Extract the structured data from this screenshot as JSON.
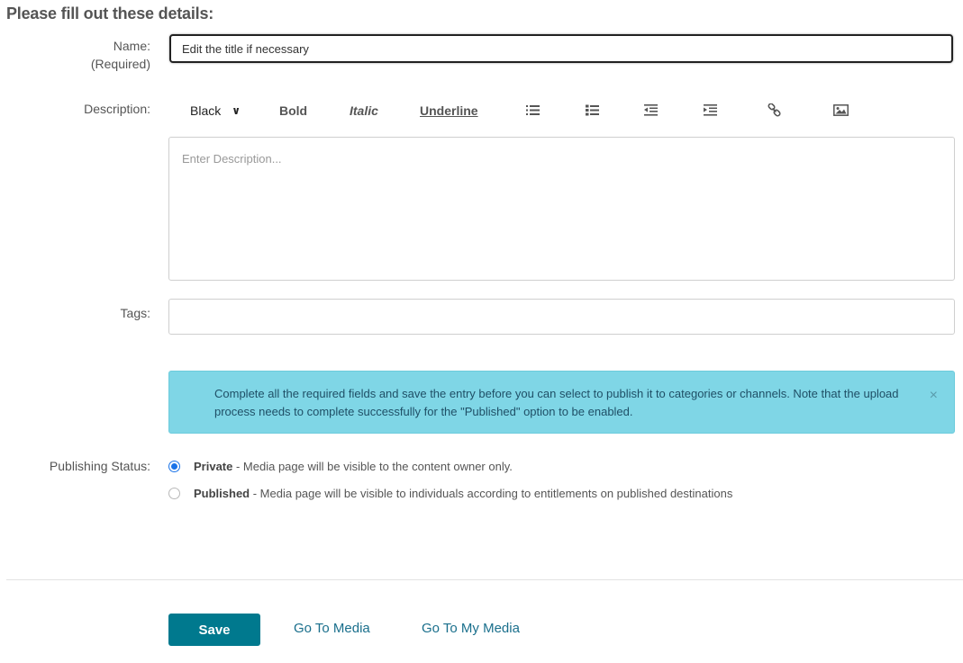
{
  "heading": "Please fill out these details:",
  "name": {
    "label": "Name:",
    "sublabel": "(Required)",
    "value": "Edit the title if necessary"
  },
  "description": {
    "label": "Description:",
    "placeholder": "Enter Description...",
    "toolbar": {
      "color": "Black",
      "bold": "Bold",
      "italic": "Italic",
      "underline": "Underline",
      "icons": [
        "unordered-list-icon",
        "ordered-list-icon",
        "outdent-icon",
        "indent-icon",
        "link-icon",
        "image-icon"
      ]
    }
  },
  "tags": {
    "label": "Tags:",
    "value": ""
  },
  "alert": {
    "text": "Complete all the required fields and save the entry before you can select to publish it to categories or channels. Note that the upload process needs to complete successfully for the \"Published\" option to be enabled.",
    "close": "×",
    "color": "#7fd6e6"
  },
  "publishing": {
    "label": "Publishing Status:",
    "options": [
      {
        "title": "Private",
        "desc": " - Media page will be visible to the content owner only.",
        "selected": true
      },
      {
        "title": "Published",
        "desc": " - Media page will be visible to individuals according to entitlements on published destinations",
        "selected": false
      }
    ]
  },
  "actions": {
    "save": "Save",
    "go_to_media": "Go To Media",
    "go_to_my_media": "Go To My Media",
    "save_color": "#00798e"
  }
}
